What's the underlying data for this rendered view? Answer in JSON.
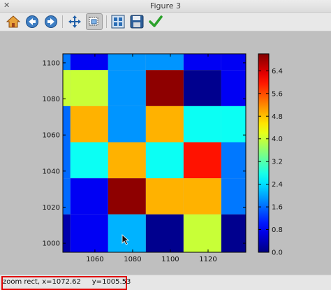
{
  "window": {
    "title": "Figure 3"
  },
  "toolbar": {
    "items": [
      {
        "name": "home-button",
        "icon": "home-icon"
      },
      {
        "name": "back-button",
        "icon": "arrow-left-icon"
      },
      {
        "name": "forward-button",
        "icon": "arrow-right-icon"
      },
      {
        "name": "pan-button",
        "icon": "move-icon"
      },
      {
        "name": "zoom-button",
        "icon": "zoom-rect-icon",
        "active": true
      },
      {
        "name": "subplots-button",
        "icon": "subplots-icon"
      },
      {
        "name": "save-button",
        "icon": "floppy-icon"
      },
      {
        "name": "edit-axes-button",
        "icon": "checkmark-icon"
      }
    ]
  },
  "status": {
    "text": "zoom rect, x=1072.62     y=1005.53"
  },
  "chart_data": {
    "type": "heatmap",
    "title": "",
    "xlabel": "",
    "ylabel": "",
    "colormap": "jet",
    "xlim": [
      1043,
      1140
    ],
    "ylim": [
      995,
      1105
    ],
    "x_ticks": [
      "1060",
      "1080",
      "1100",
      "1120"
    ],
    "x_tick_values": [
      1060,
      1080,
      1100,
      1120
    ],
    "y_ticks": [
      "1000",
      "1020",
      "1040",
      "1060",
      "1080",
      "1100"
    ],
    "y_tick_values": [
      1000,
      1020,
      1040,
      1060,
      1080,
      1100
    ],
    "colorbar": {
      "min": 0.0,
      "max": 7.0,
      "ticks": [
        "0.0",
        "0.8",
        "1.6",
        "2.4",
        "3.2",
        "4.0",
        "4.8",
        "5.6",
        "6.4"
      ],
      "tick_values": [
        0,
        0.8,
        1.6,
        2.4,
        3.2,
        4.0,
        4.8,
        5.6,
        6.4
      ]
    },
    "cells": [
      {
        "x0": 1043,
        "x1": 1047,
        "y0": 1096,
        "y1": 1105,
        "value": 1.7
      },
      {
        "x0": 1043,
        "x1": 1047,
        "y0": 1076,
        "y1": 1096,
        "value": 4.0
      },
      {
        "x0": 1043,
        "x1": 1047,
        "y0": 1056,
        "y1": 1076,
        "value": 1.6
      },
      {
        "x0": 1043,
        "x1": 1047,
        "y0": 1036,
        "y1": 1056,
        "value": 1.6
      },
      {
        "x0": 1043,
        "x1": 1047,
        "y0": 1016,
        "y1": 1036,
        "value": 1.6
      },
      {
        "x0": 1043,
        "x1": 1047,
        "y0": 995,
        "y1": 1016,
        "value": 0.3
      },
      {
        "x0": 1047,
        "x1": 1067,
        "y0": 1096,
        "y1": 1105,
        "value": 0.8
      },
      {
        "x0": 1047,
        "x1": 1067,
        "y0": 1076,
        "y1": 1096,
        "value": 4.0
      },
      {
        "x0": 1047,
        "x1": 1067,
        "y0": 1056,
        "y1": 1076,
        "value": 4.9
      },
      {
        "x0": 1047,
        "x1": 1067,
        "y0": 1036,
        "y1": 1056,
        "value": 2.7
      },
      {
        "x0": 1047,
        "x1": 1067,
        "y0": 1016,
        "y1": 1036,
        "value": 0.8
      },
      {
        "x0": 1047,
        "x1": 1067,
        "y0": 995,
        "y1": 1016,
        "value": 0.8
      },
      {
        "x0": 1067,
        "x1": 1087,
        "y0": 1096,
        "y1": 1105,
        "value": 1.9
      },
      {
        "x0": 1067,
        "x1": 1087,
        "y0": 1076,
        "y1": 1096,
        "value": 1.9
      },
      {
        "x0": 1067,
        "x1": 1087,
        "y0": 1056,
        "y1": 1076,
        "value": 1.9
      },
      {
        "x0": 1067,
        "x1": 1087,
        "y0": 1036,
        "y1": 1056,
        "value": 4.9
      },
      {
        "x0": 1067,
        "x1": 1087,
        "y0": 1016,
        "y1": 1036,
        "value": 6.9
      },
      {
        "x0": 1067,
        "x1": 1087,
        "y0": 995,
        "y1": 1016,
        "value": 2.1
      },
      {
        "x0": 1087,
        "x1": 1107,
        "y0": 1096,
        "y1": 1105,
        "value": 1.9
      },
      {
        "x0": 1087,
        "x1": 1107,
        "y0": 1076,
        "y1": 1096,
        "value": 6.9
      },
      {
        "x0": 1087,
        "x1": 1107,
        "y0": 1056,
        "y1": 1076,
        "value": 4.9
      },
      {
        "x0": 1087,
        "x1": 1107,
        "y0": 1036,
        "y1": 1056,
        "value": 2.7
      },
      {
        "x0": 1087,
        "x1": 1107,
        "y0": 1016,
        "y1": 1036,
        "value": 4.9
      },
      {
        "x0": 1087,
        "x1": 1107,
        "y0": 995,
        "y1": 1016,
        "value": 0.1
      },
      {
        "x0": 1107,
        "x1": 1127,
        "y0": 1096,
        "y1": 1105,
        "value": 0.8
      },
      {
        "x0": 1107,
        "x1": 1127,
        "y0": 1076,
        "y1": 1096,
        "value": 0.1
      },
      {
        "x0": 1107,
        "x1": 1127,
        "y0": 1056,
        "y1": 1076,
        "value": 2.7
      },
      {
        "x0": 1107,
        "x1": 1127,
        "y0": 1036,
        "y1": 1056,
        "value": 6.0
      },
      {
        "x0": 1107,
        "x1": 1127,
        "y0": 1016,
        "y1": 1036,
        "value": 4.9
      },
      {
        "x0": 1107,
        "x1": 1127,
        "y0": 995,
        "y1": 1016,
        "value": 4.0
      },
      {
        "x0": 1127,
        "x1": 1140,
        "y0": 1096,
        "y1": 1105,
        "value": 0.8
      },
      {
        "x0": 1127,
        "x1": 1140,
        "y0": 1076,
        "y1": 1096,
        "value": 0.8
      },
      {
        "x0": 1127,
        "x1": 1140,
        "y0": 1056,
        "y1": 1076,
        "value": 2.7
      },
      {
        "x0": 1127,
        "x1": 1140,
        "y0": 1036,
        "y1": 1056,
        "value": 1.7
      },
      {
        "x0": 1127,
        "x1": 1140,
        "y0": 1016,
        "y1": 1036,
        "value": 1.7
      },
      {
        "x0": 1127,
        "x1": 1140,
        "y0": 995,
        "y1": 1016,
        "value": 0.1
      }
    ]
  }
}
